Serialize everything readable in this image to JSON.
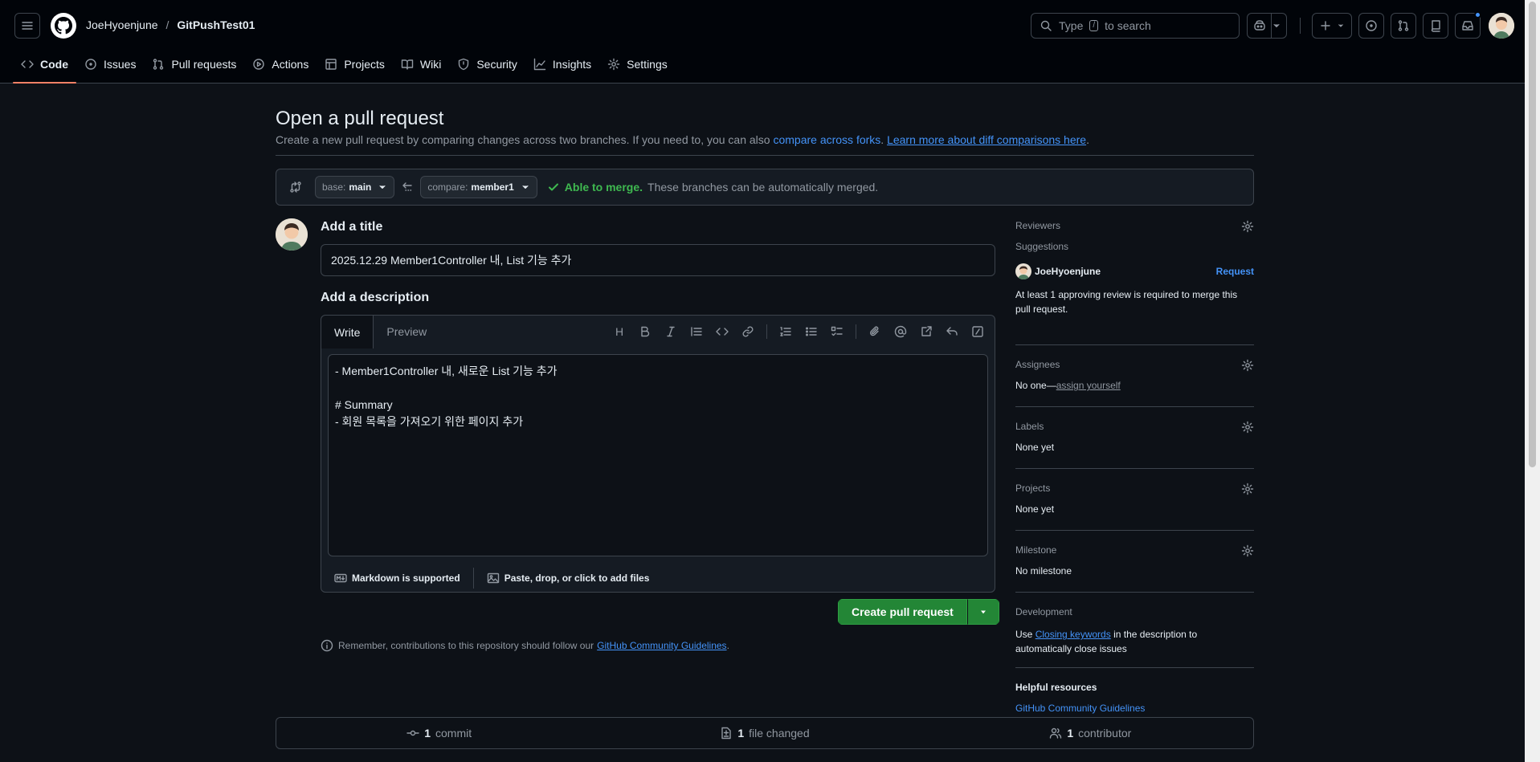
{
  "header": {
    "owner": "JoeHyoenjune",
    "separator": "/",
    "repo": "GitPushTest01",
    "search_prefix": "Type",
    "search_key": "/",
    "search_suffix": "to search"
  },
  "tabs": [
    {
      "label": "Code",
      "icon": "code-icon",
      "selected": true
    },
    {
      "label": "Issues",
      "icon": "issue-opened-icon"
    },
    {
      "label": "Pull requests",
      "icon": "git-pull-request-icon"
    },
    {
      "label": "Actions",
      "icon": "play-icon"
    },
    {
      "label": "Projects",
      "icon": "table-icon"
    },
    {
      "label": "Wiki",
      "icon": "book-icon"
    },
    {
      "label": "Security",
      "icon": "shield-icon"
    },
    {
      "label": "Insights",
      "icon": "graph-icon"
    },
    {
      "label": "Settings",
      "icon": "gear-icon"
    }
  ],
  "page": {
    "title": "Open a pull request",
    "subtitle_text": "Create a new pull request by comparing changes across two branches. If you need to, you can also",
    "subtitle_link1": "compare across forks",
    "subtitle_mid": ".",
    "subtitle_link2": "Learn more about diff comparisons here",
    "subtitle_end": "."
  },
  "compare": {
    "base_label": "base:",
    "base_value": "main",
    "compare_label": "compare:",
    "compare_value": "member1",
    "merge_status": "Able to merge.",
    "merge_message": "These branches can be automatically merged."
  },
  "form": {
    "title_label": "Add a title",
    "title_value": "2025.12.29 Member1Controller 내, List 기능 추가",
    "description_label": "Add a description",
    "tab_write": "Write",
    "tab_preview": "Preview",
    "tool_heading": "H",
    "description_value": "- Member1Controller 내, 새로운 List 기능 추가\n\n# Summary\n- 회원 목록을 가져오기 위한 페이지 추가",
    "markdown_note": "Markdown is supported",
    "attach_note": "Paste, drop, or click to add files",
    "create_button": "Create pull request",
    "remember_text": "Remember, contributions to this repository should follow our",
    "remember_link": "GitHub Community Guidelines",
    "remember_end": "."
  },
  "sidebar": {
    "reviewers": {
      "heading": "Reviewers",
      "suggestions": "Suggestions",
      "suggested_user": "JoeHyoenjune",
      "request": "Request",
      "note": "At least 1 approving review is required to merge this pull request."
    },
    "assignees": {
      "heading": "Assignees",
      "value_prefix": "No one—",
      "value_link": "assign yourself"
    },
    "labels": {
      "heading": "Labels",
      "value": "None yet"
    },
    "projects": {
      "heading": "Projects",
      "value": "None yet"
    },
    "milestone": {
      "heading": "Milestone",
      "value": "No milestone"
    },
    "development": {
      "heading": "Development",
      "text1": "Use",
      "link": "Closing keywords",
      "text2": "in the description to automatically close issues"
    },
    "helpful": {
      "heading": "Helpful resources",
      "link": "GitHub Community Guidelines"
    }
  },
  "stats": {
    "commits_count": "1",
    "commits_label": "commit",
    "files_count": "1",
    "files_label": "file changed",
    "contributors_count": "1",
    "contributors_label": "contributor"
  },
  "colors": {
    "accent": "#f78166",
    "success": "#3fb950",
    "button": "#238636",
    "link": "#4493f8",
    "background": "#0d1117"
  }
}
